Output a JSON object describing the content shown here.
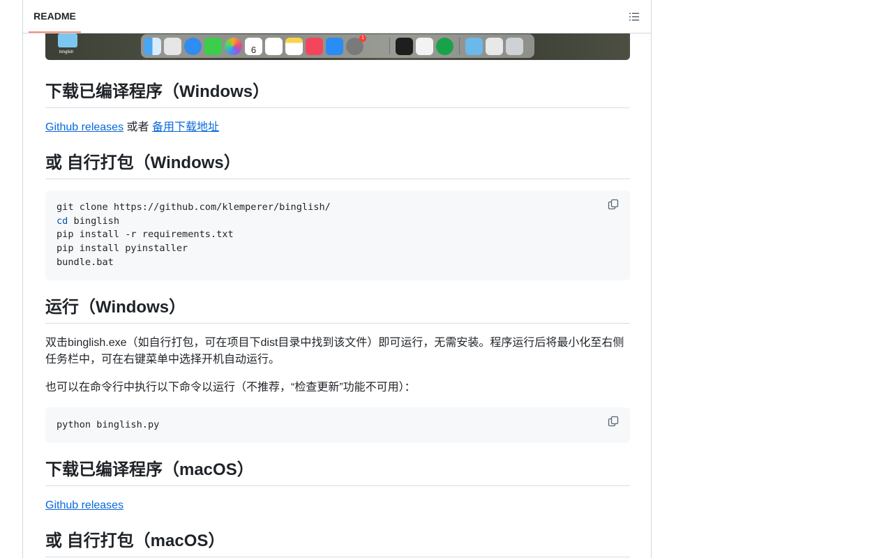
{
  "header": {
    "tab_label": "README"
  },
  "screenshot": {
    "folder_label": "binglish",
    "dock_calendar_day": "6",
    "dock_badge": "1"
  },
  "sections": [
    {
      "title": "下载已编译程序（Windows）",
      "links": [
        "Github releases",
        "备用下载地址"
      ],
      "connector": " 或者 "
    },
    {
      "title": "或 自行打包（Windows）",
      "code": [
        {
          "kw": "",
          "text": "git clone https://github.com/klemperer/binglish/"
        },
        {
          "kw": "cd",
          "text": " binglish"
        },
        {
          "kw": "",
          "text": "pip install -r requirements.txt"
        },
        {
          "kw": "",
          "text": "pip install pyinstaller"
        },
        {
          "kw": "",
          "text": "bundle.bat"
        }
      ]
    },
    {
      "title": "运行（Windows）",
      "para1": "双击binglish.exe（如自行打包，可在项目下dist目录中找到该文件）即可运行，无需安装。程序运行后将最小化至右侧任务栏中，可在右键菜单中选择开机自动运行。",
      "para2": "也可以在命令行中执行以下命令以运行（不推荐，“检查更新”功能不可用）：",
      "code": "python binglish.py"
    },
    {
      "title": "下载已编译程序（macOS）",
      "link": "Github releases"
    },
    {
      "title": "或 自行打包（macOS）"
    }
  ],
  "colors": {
    "link": "#0969da",
    "tab_underline": "#fd8c73",
    "code_bg": "#f6f8fa"
  }
}
